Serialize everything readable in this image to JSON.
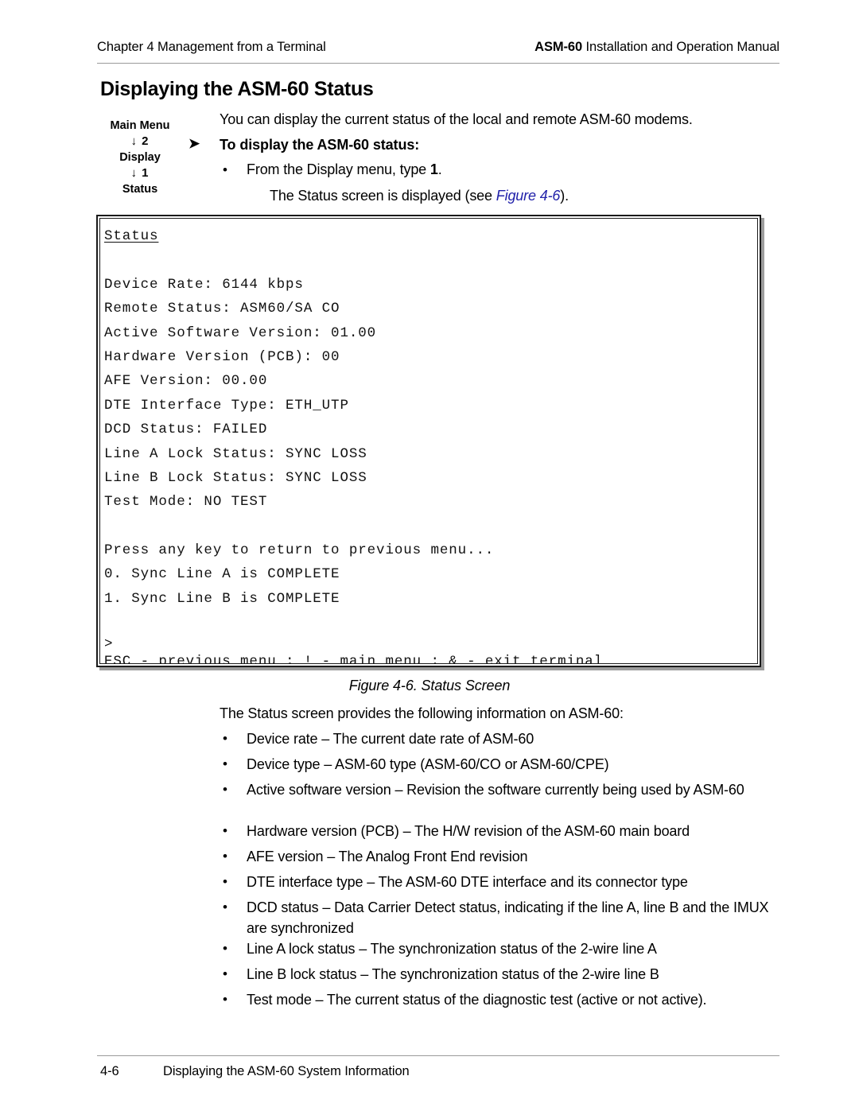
{
  "header": {
    "left": "Chapter 4  Management from a Terminal",
    "right_bold": "ASM-60",
    "right_rest": " Installation and Operation Manual"
  },
  "section": {
    "title": "Displaying the ASM-60 Status"
  },
  "navpath": {
    "items": [
      "Main Menu",
      "↓ 2",
      "Display",
      "↓ 1",
      "Status"
    ]
  },
  "intro": {
    "text": "You can display the current status of the local and remote ASM-60 modems."
  },
  "procedure": {
    "marker": "➤",
    "heading": "To display the ASM-60 status:",
    "step_bullet": "•",
    "step_text_before": "From the Display menu, type ",
    "step_text_bold": "1",
    "step_text_after": ".",
    "sub_before": "The Status screen is displayed (see ",
    "sub_link": "Figure 4-6",
    "sub_after": ").",
    "link_color": "#2222aa"
  },
  "terminal": {
    "title_line": "Status",
    "lines": [
      "Device Rate: 6144 kbps",
      "Remote Status: ASM60/SA CO",
      "Active Software Version: 01.00",
      "Hardware Version (PCB): 00",
      "AFE Version: 00.00",
      "DTE Interface Type: ETH_UTP",
      "DCD Status: FAILED",
      "Line A Lock Status: SYNC LOSS",
      "Line B Lock Status: SYNC LOSS",
      "Test Mode: NO TEST",
      "",
      "Press any key to return to previous menu...",
      "0. Sync Line A is COMPLETE",
      "1. Sync Line B is COMPLETE",
      ""
    ],
    "prompt": ">",
    "help_line": "ESC - previous menu ; ! - main menu ; & - exit terminal",
    "separator": "------------------------------------------------------"
  },
  "figure": {
    "caption": "Figure 4-6.  Status Screen"
  },
  "description": {
    "intro": "The Status screen provides the following information on ASM-60:",
    "bullet_char": "•",
    "items": [
      "Device rate – The current date rate of ASM-60",
      "Device type – ASM-60 type (ASM-60/CO or ASM-60/CPE)",
      "Active software version – Revision the software currently being used by ASM-60",
      "Hardware version (PCB) – The H/W revision of the ASM-60 main board",
      "AFE version – The Analog Front End revision",
      "DTE interface type – The ASM-60 DTE interface and its connector type",
      "DCD status – Data Carrier Detect status, indicating if the line A, line B and the IMUX are synchronized",
      "Line A lock status – The synchronization status of the 2-wire line A",
      "Line B lock status – The synchronization status of the 2-wire line B",
      "Test mode – The current status of the diagnostic test (active or not active)."
    ]
  },
  "footer": {
    "page_number": "4-6",
    "text": "Displaying the ASM-60 System Information"
  }
}
